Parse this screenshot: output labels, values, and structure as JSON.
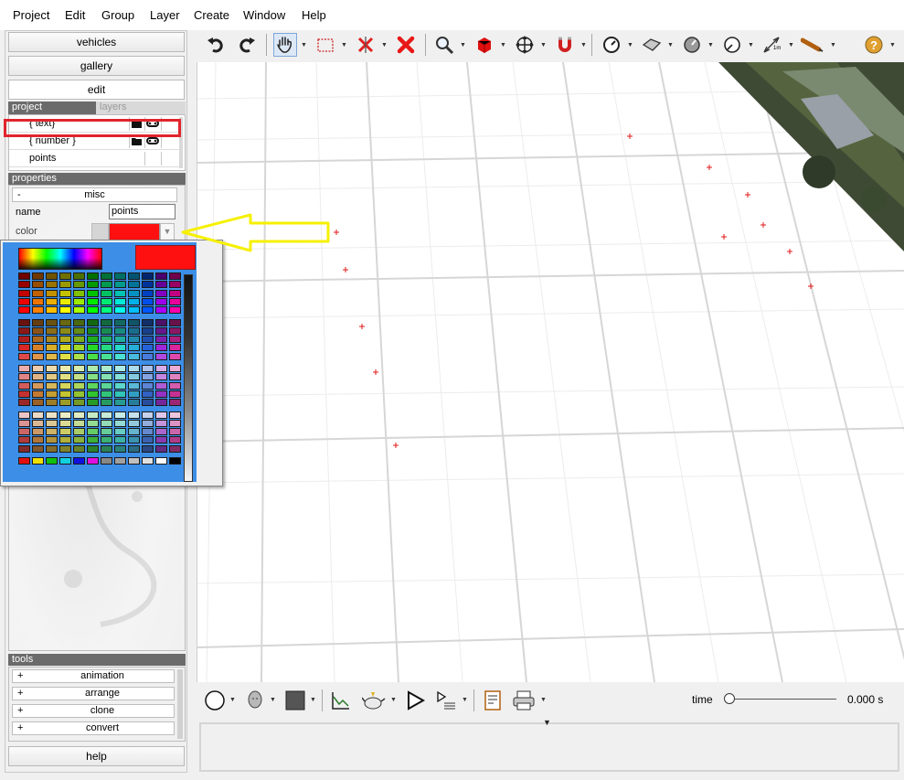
{
  "menu": [
    "Project",
    "Edit",
    "Group",
    "Layer",
    "Create",
    "Window",
    "Help"
  ],
  "sidebar": {
    "buttons": {
      "vehicles": "vehicles",
      "gallery": "gallery",
      "edit": "edit",
      "help": "help"
    },
    "tabs": {
      "project": "project",
      "layers": "layers"
    },
    "layers": [
      {
        "label": "{ text}"
      },
      {
        "label": "{ number }"
      },
      {
        "label": "points"
      }
    ],
    "properties": {
      "header": "properties",
      "group_toggle": "-",
      "group": "misc",
      "name_label": "name",
      "name_value": "points",
      "color_label": "color",
      "color_value": "#ff1010"
    },
    "tools": {
      "header": "tools",
      "items": [
        {
          "toggle": "+",
          "label": "animation"
        },
        {
          "toggle": "+",
          "label": "arrange"
        },
        {
          "toggle": "+",
          "label": "clone"
        },
        {
          "toggle": "+",
          "label": "convert"
        }
      ]
    }
  },
  "toolbar": {
    "tools": [
      "undo-icon",
      "redo-icon",
      "pan-hand-icon",
      "select-rect-icon",
      "delete-points-icon",
      "delete-icon",
      "zoom-icon",
      "cube-icon",
      "move-icon",
      "magnet-icon",
      "gauge-icon",
      "surface-icon",
      "dial-icon",
      "compass-icon",
      "measure-icon",
      "pen-icon",
      "help-icon"
    ],
    "measure_label": "1m"
  },
  "bottom_toolbar": {
    "time_label": "time",
    "time_value": "0.000 s",
    "time_position": 0
  },
  "color_popup": {
    "selected_color": "#ff1010",
    "bottom_row": [
      "#e01010",
      "#f0e000",
      "#10c010",
      "#10d0e0",
      "#1010e0",
      "#e010e0",
      "#888888",
      "#a0a0a0",
      "#c0c0c0",
      "#e0e0e0",
      "#ffffff",
      "#000000"
    ]
  },
  "colors": {
    "highlight": "#e0242c",
    "annotation_arrow": "#f6f000",
    "point_marker": "#e01818"
  }
}
